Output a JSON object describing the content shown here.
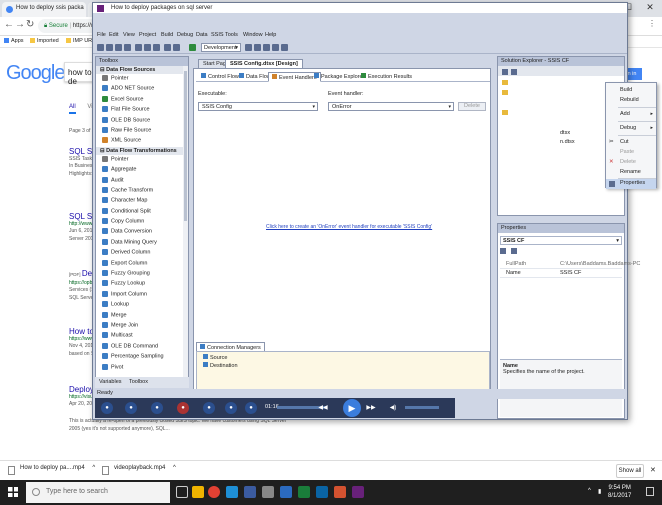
{
  "browser": {
    "tabs": [
      {
        "label": "How to deploy ssis packa"
      },
      {
        "label": ""
      }
    ],
    "window_controls": {
      "minimize": "—",
      "maximize": "☐",
      "close": "✕"
    },
    "omnibox": {
      "secure_label": "Secure",
      "url": "https://www"
    },
    "bookmarks": [
      {
        "label": "Apps"
      },
      {
        "label": "Imported"
      },
      {
        "label": "IMP URL"
      }
    ]
  },
  "google": {
    "logo": "Google",
    "query": "how to de",
    "tab_all": "All",
    "tab_videos": "Vid",
    "result_count": "Page 3 of a",
    "sign_in": "n in",
    "results": [
      {
        "title": "SQL Ser",
        "url": "",
        "lines": [
          "SSIS Tasks",
          "In Business",
          "Highlights:"
        ]
      },
      {
        "title": "SQL Se",
        "url": "http://www.datab",
        "lines": [
          "Jun 6, 2012",
          "Server 201"
        ]
      },
      {
        "title": "Deplo",
        "prefix": "[PDF]",
        "url": "https://opb",
        "lines": [
          "Services (S",
          "SQL Serve"
        ]
      },
      {
        "title": "How to",
        "url": "https://www",
        "lines": [
          "Nov 4, 2016",
          "based on S"
        ]
      },
      {
        "title": "Deploy S",
        "url": "https://visu",
        "lines": [
          "Apr 20, 201"
        ]
      }
    ],
    "bottom_lines": [
      "This is actually a re-open of a previously closed SSIS topic. We have customers using SQL Server",
      "2005 (yes it's not supported anymore), SQL..."
    ]
  },
  "vs": {
    "title": "How to deploy packages on sql server",
    "menu": [
      "File",
      "Edit",
      "View",
      "Project",
      "Build",
      "Debug",
      "Data",
      "SSIS",
      "Tools",
      "Window",
      "Help"
    ],
    "config": "Development",
    "toolbox": {
      "header": "Toolbox",
      "sections": [
        {
          "name": "Data Flow Sources",
          "items": [
            "Pointer",
            "ADO NET Source",
            "Excel Source",
            "Flat File Source",
            "OLE DB Source",
            "Raw File Source",
            "XML Source"
          ]
        },
        {
          "name": "Data Flow Transformations",
          "items": [
            "Pointer",
            "Aggregate",
            "Audit",
            "Cache Transform",
            "Character Map",
            "Conditional Split",
            "Copy Column",
            "Data Conversion",
            "Data Mining Query",
            "Derived Column",
            "Export Column",
            "Fuzzy Grouping",
            "Fuzzy Lookup",
            "Import Column",
            "Lookup",
            "Merge",
            "Merge Join",
            "Multicast",
            "OLE DB Command",
            "Percentage Sampling",
            "Pivot"
          ]
        }
      ],
      "bottom_tabs": [
        "Variables",
        "Toolbox"
      ]
    },
    "doc_tabs": [
      "Start Page",
      "SSIS Config.dtsx [Design]"
    ],
    "designer_tabs": [
      "Control Flow",
      "Data Flow",
      "Event Handlers",
      "Package Explorer",
      "Execution Results"
    ],
    "executable_label": "Executable:",
    "executable_value": "SSIS Config",
    "event_handler_label": "Event handler:",
    "event_handler_value": "OnError",
    "delete_label": "Delete",
    "create_link": "Click here to create an 'OnError' event handler for executable 'SSIS Config'",
    "conn_mgr_tab": "Connection Managers",
    "conn_mgr_items": [
      "Source",
      "Destination"
    ],
    "status": "Ready",
    "solution_explorer": {
      "header": "Solution Explorer - SSIS CF",
      "partial_items": [
        "dtsx",
        "n.dtsx"
      ]
    },
    "context_menu": [
      {
        "label": "Build",
        "sub": false,
        "disabled": false
      },
      {
        "label": "Rebuild",
        "sub": false,
        "disabled": false
      },
      {
        "label": "Add",
        "sub": true,
        "disabled": false
      },
      {
        "label": "Debug",
        "sub": true,
        "disabled": false
      },
      {
        "label": "Cut",
        "sub": false,
        "disabled": false
      },
      {
        "label": "Paste",
        "sub": false,
        "disabled": true
      },
      {
        "label": "Delete",
        "sub": false,
        "disabled": true
      },
      {
        "label": "Rename",
        "sub": false,
        "disabled": false
      },
      {
        "label": "Properties",
        "sub": false,
        "disabled": false
      }
    ],
    "properties": {
      "header": "Properties",
      "object": "SSIS CF",
      "rows": [
        {
          "name": "FullPath",
          "value": "C:\\Users\\Baddams.Baddams-PC"
        },
        {
          "name": "Name",
          "value": "SSIS CF"
        }
      ],
      "desc_title": "Name",
      "desc_text": "Specifies the name of the project."
    }
  },
  "player": {
    "time": "01:16"
  },
  "downloads": {
    "items": [
      "How to deploy pa....mp4",
      "videoplayback.mp4"
    ],
    "show_all": "Show all"
  },
  "taskbar": {
    "search_placeholder": "Type here to search",
    "time": "9:54 PM",
    "date": "8/1/2017"
  }
}
